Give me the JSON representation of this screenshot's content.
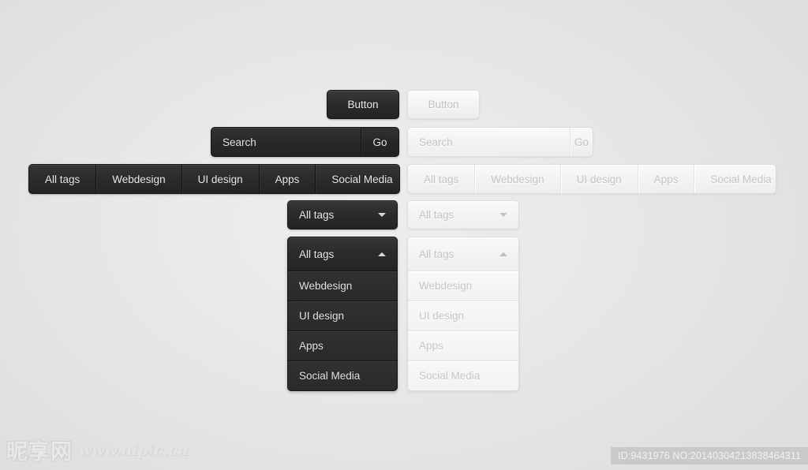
{
  "page": {
    "background_color": "#e4e4e4",
    "center_color": "#ededed"
  },
  "dark_theme": {
    "button": {
      "label": "Button"
    },
    "search": {
      "value": "Search",
      "go_label": "Go"
    },
    "tabs": [
      {
        "label": "All tags"
      },
      {
        "label": "Webdesign"
      },
      {
        "label": "UI design"
      },
      {
        "label": "Apps"
      },
      {
        "label": "Social Media"
      }
    ],
    "select_closed": {
      "value": "All tags",
      "caret": "chevron-down-icon"
    },
    "dropdown_open": {
      "value": "All tags",
      "caret": "chevron-up-icon",
      "options": [
        {
          "label": "Webdesign"
        },
        {
          "label": "UI design"
        },
        {
          "label": "Apps"
        },
        {
          "label": "Social Media"
        }
      ]
    }
  },
  "light_theme": {
    "button": {
      "label": "Button"
    },
    "search": {
      "placeholder": "Search",
      "value": "",
      "go_label": "Go"
    },
    "tabs": [
      {
        "label": "All tags"
      },
      {
        "label": "Webdesign"
      },
      {
        "label": "UI design"
      },
      {
        "label": "Apps"
      },
      {
        "label": "Social Media"
      }
    ],
    "select_closed": {
      "value": "All tags",
      "caret": "chevron-down-icon"
    },
    "dropdown_open": {
      "value": "All tags",
      "caret": "chevron-up-icon",
      "options": [
        {
          "label": "Webdesign"
        },
        {
          "label": "UI design"
        },
        {
          "label": "Apps"
        },
        {
          "label": "Social Media"
        }
      ]
    }
  },
  "watermark": {
    "cjk": "昵享网",
    "url": "www.nipic.cn",
    "id_text": "ID:9431976 NO:20140304213838464311"
  }
}
